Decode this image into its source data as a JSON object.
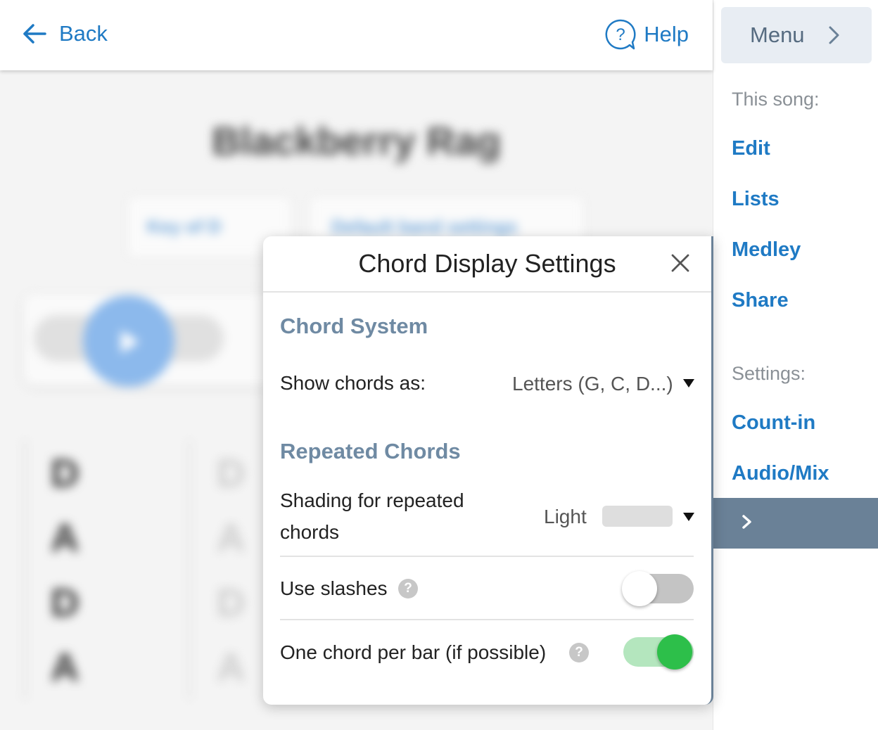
{
  "topbar": {
    "back_label": "Back",
    "help_label": "Help"
  },
  "background": {
    "song_title": "Blackberry Rag",
    "key_label": "Key of D",
    "band_label": "Default band settings",
    "chords": [
      "D",
      "A",
      "D",
      "A"
    ],
    "chords_faint": [
      "D",
      "A",
      "D",
      "A"
    ]
  },
  "sidebar": {
    "menu_label": "Menu",
    "song_section_label": "This song:",
    "song_links": [
      "Edit",
      "Lists",
      "Medley",
      "Share"
    ],
    "settings_section_label": "Settings:",
    "settings_links": [
      "Count-in",
      "Audio/Mix"
    ],
    "collapse_icon": "chevron-right-icon"
  },
  "dialog": {
    "title": "Chord Display Settings",
    "chord_system": {
      "heading": "Chord System",
      "show_chords_label": "Show chords as:",
      "show_chords_value": "Letters (G, C, D...)"
    },
    "repeated_chords": {
      "heading": "Repeated Chords",
      "shading_label_line1": "Shading for repeated",
      "shading_label_line2": "chords",
      "shading_value": "Light",
      "use_slashes_label": "Use slashes",
      "use_slashes_on": false,
      "one_chord_label": "One chord per bar (if possible)",
      "one_chord_on": true
    }
  },
  "colors": {
    "link": "#1f7ac4",
    "toggle_on": "#2dbf4a",
    "toggle_on_track": "#b4e6be",
    "toggle_off_track": "#c4c4c4",
    "section_heading": "#6f8aa3"
  }
}
